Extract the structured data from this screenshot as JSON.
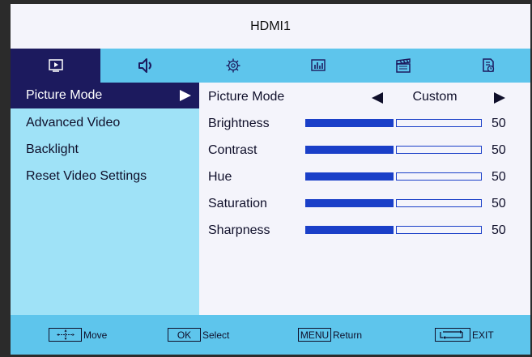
{
  "header": {
    "title": "HDMI1"
  },
  "tabs": [
    {
      "name": "picture",
      "icon": "picture-icon",
      "active": true
    },
    {
      "name": "audio",
      "icon": "speaker-icon",
      "active": false
    },
    {
      "name": "setup",
      "icon": "gear-icon",
      "active": false
    },
    {
      "name": "options",
      "icon": "equalizer-icon",
      "active": false
    },
    {
      "name": "channel",
      "icon": "clapperboard-icon",
      "active": false
    },
    {
      "name": "lock",
      "icon": "timer-document-icon",
      "active": false
    }
  ],
  "sidebar": {
    "items": [
      {
        "label": "Picture Mode",
        "selected": true
      },
      {
        "label": "Advanced Video",
        "selected": false
      },
      {
        "label": "Backlight",
        "selected": false
      },
      {
        "label": "Reset Video Settings",
        "selected": false
      }
    ]
  },
  "settings": {
    "picture_mode": {
      "label": "Picture Mode",
      "value": "Custom"
    },
    "sliders": [
      {
        "label": "Brightness",
        "value": "50",
        "level": 0.5
      },
      {
        "label": "Contrast",
        "value": "50",
        "level": 0.5
      },
      {
        "label": "Hue",
        "value": "50",
        "level": 0.5
      },
      {
        "label": "Saturation",
        "value": "50",
        "level": 0.5
      },
      {
        "label": "Sharpness",
        "value": "50",
        "level": 0.5
      }
    ]
  },
  "footer": {
    "move": {
      "key": "",
      "label": "Move"
    },
    "select": {
      "key": "OK",
      "label": "Select"
    },
    "return": {
      "key": "MENU",
      "label": "Return"
    },
    "exit": {
      "key": "",
      "label": "EXIT"
    }
  },
  "colors": {
    "selected_bg": "#1c1a5e",
    "tab_bar": "#5ec5ec",
    "sidebar": "#9fe2f7",
    "slider": "#1a3fc8",
    "panel": "#f4f4fb"
  }
}
